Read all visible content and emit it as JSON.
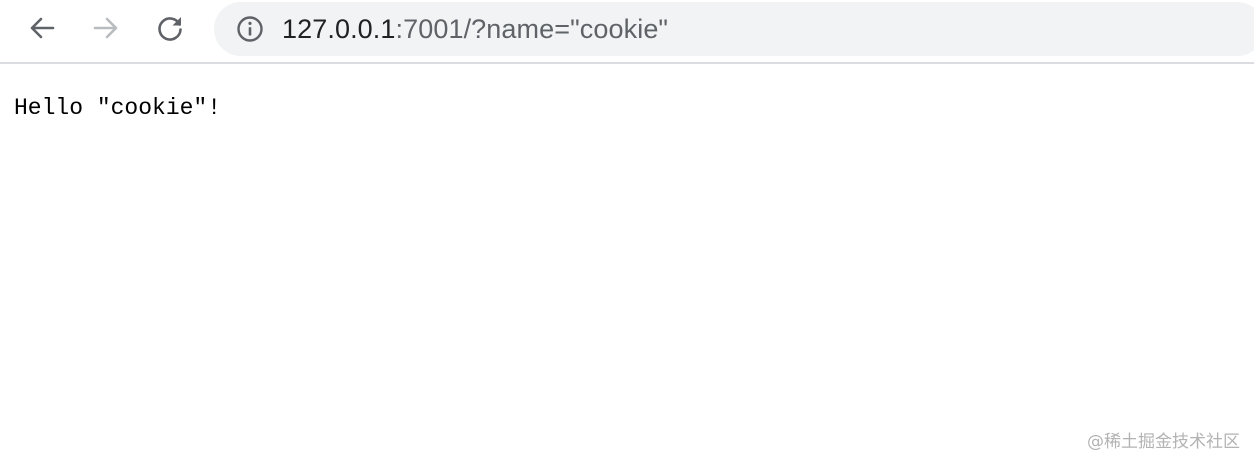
{
  "toolbar": {
    "back_icon": "arrow-left-icon",
    "forward_icon": "arrow-right-icon",
    "reload_icon": "reload-icon",
    "info_icon": "info-circle-icon"
  },
  "address_bar": {
    "host": "127.0.0.1",
    "rest": ":7001/?name=\"cookie\""
  },
  "page": {
    "text": "Hello \"cookie\"!"
  },
  "watermark": {
    "text": "@稀土掘金技术社区"
  },
  "colors": {
    "icon_active": "#5f6368",
    "icon_disabled": "#b9bcbf",
    "omnibox_bg": "#f1f3f4"
  }
}
